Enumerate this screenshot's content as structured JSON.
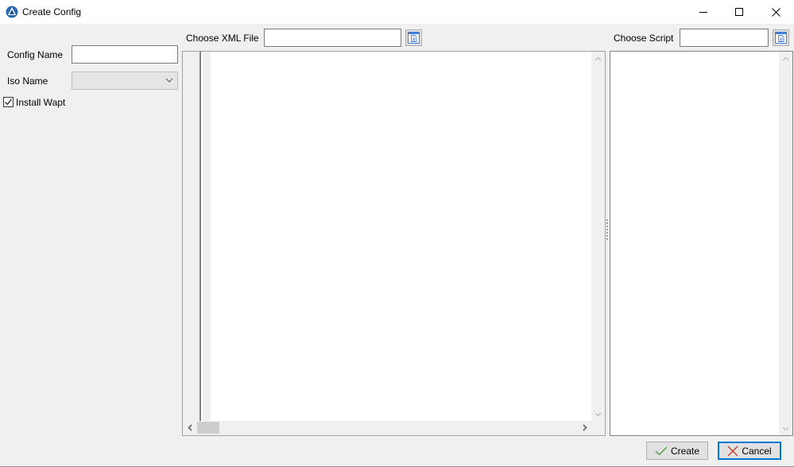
{
  "window": {
    "title": "Create Config",
    "controls": {
      "minimize": "minimize",
      "maximize": "maximize",
      "close": "close"
    }
  },
  "left_panel": {
    "config_name_label": "Config Name",
    "config_name_value": "",
    "iso_name_label": "Iso Name",
    "iso_name_value": "",
    "install_wapt_label": "Install Wapt",
    "install_wapt_checked": true
  },
  "xml_panel": {
    "choose_label": "Choose XML File",
    "file_value": "",
    "editor_content": ""
  },
  "script_panel": {
    "choose_label": "Choose Script",
    "file_value": "",
    "editor_content": ""
  },
  "footer": {
    "create_label": "Create",
    "cancel_label": "Cancel"
  },
  "colors": {
    "accent": "#0078d7",
    "create_icon": "#4c9a3e",
    "cancel_icon": "#c0392b"
  }
}
